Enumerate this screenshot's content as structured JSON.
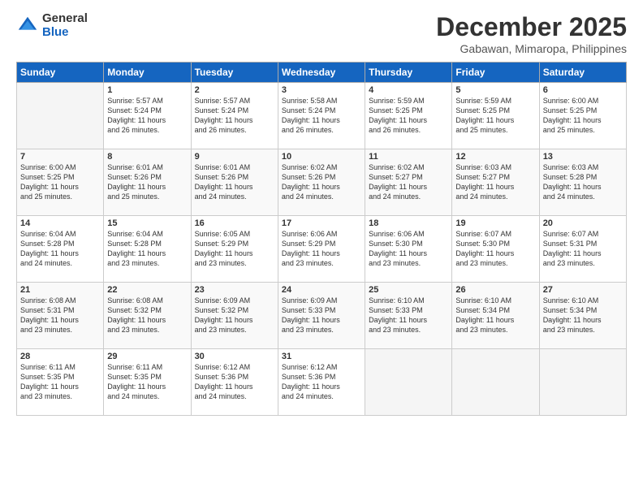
{
  "logo": {
    "general": "General",
    "blue": "Blue"
  },
  "title": "December 2025",
  "subtitle": "Gabawan, Mimaropa, Philippines",
  "weekdays": [
    "Sunday",
    "Monday",
    "Tuesday",
    "Wednesday",
    "Thursday",
    "Friday",
    "Saturday"
  ],
  "weeks": [
    [
      {
        "day": "",
        "info": ""
      },
      {
        "day": "1",
        "info": "Sunrise: 5:57 AM\nSunset: 5:24 PM\nDaylight: 11 hours\nand 26 minutes."
      },
      {
        "day": "2",
        "info": "Sunrise: 5:57 AM\nSunset: 5:24 PM\nDaylight: 11 hours\nand 26 minutes."
      },
      {
        "day": "3",
        "info": "Sunrise: 5:58 AM\nSunset: 5:24 PM\nDaylight: 11 hours\nand 26 minutes."
      },
      {
        "day": "4",
        "info": "Sunrise: 5:59 AM\nSunset: 5:25 PM\nDaylight: 11 hours\nand 26 minutes."
      },
      {
        "day": "5",
        "info": "Sunrise: 5:59 AM\nSunset: 5:25 PM\nDaylight: 11 hours\nand 25 minutes."
      },
      {
        "day": "6",
        "info": "Sunrise: 6:00 AM\nSunset: 5:25 PM\nDaylight: 11 hours\nand 25 minutes."
      }
    ],
    [
      {
        "day": "7",
        "info": "Sunrise: 6:00 AM\nSunset: 5:25 PM\nDaylight: 11 hours\nand 25 minutes."
      },
      {
        "day": "8",
        "info": "Sunrise: 6:01 AM\nSunset: 5:26 PM\nDaylight: 11 hours\nand 25 minutes."
      },
      {
        "day": "9",
        "info": "Sunrise: 6:01 AM\nSunset: 5:26 PM\nDaylight: 11 hours\nand 24 minutes."
      },
      {
        "day": "10",
        "info": "Sunrise: 6:02 AM\nSunset: 5:26 PM\nDaylight: 11 hours\nand 24 minutes."
      },
      {
        "day": "11",
        "info": "Sunrise: 6:02 AM\nSunset: 5:27 PM\nDaylight: 11 hours\nand 24 minutes."
      },
      {
        "day": "12",
        "info": "Sunrise: 6:03 AM\nSunset: 5:27 PM\nDaylight: 11 hours\nand 24 minutes."
      },
      {
        "day": "13",
        "info": "Sunrise: 6:03 AM\nSunset: 5:28 PM\nDaylight: 11 hours\nand 24 minutes."
      }
    ],
    [
      {
        "day": "14",
        "info": "Sunrise: 6:04 AM\nSunset: 5:28 PM\nDaylight: 11 hours\nand 24 minutes."
      },
      {
        "day": "15",
        "info": "Sunrise: 6:04 AM\nSunset: 5:28 PM\nDaylight: 11 hours\nand 23 minutes."
      },
      {
        "day": "16",
        "info": "Sunrise: 6:05 AM\nSunset: 5:29 PM\nDaylight: 11 hours\nand 23 minutes."
      },
      {
        "day": "17",
        "info": "Sunrise: 6:06 AM\nSunset: 5:29 PM\nDaylight: 11 hours\nand 23 minutes."
      },
      {
        "day": "18",
        "info": "Sunrise: 6:06 AM\nSunset: 5:30 PM\nDaylight: 11 hours\nand 23 minutes."
      },
      {
        "day": "19",
        "info": "Sunrise: 6:07 AM\nSunset: 5:30 PM\nDaylight: 11 hours\nand 23 minutes."
      },
      {
        "day": "20",
        "info": "Sunrise: 6:07 AM\nSunset: 5:31 PM\nDaylight: 11 hours\nand 23 minutes."
      }
    ],
    [
      {
        "day": "21",
        "info": "Sunrise: 6:08 AM\nSunset: 5:31 PM\nDaylight: 11 hours\nand 23 minutes."
      },
      {
        "day": "22",
        "info": "Sunrise: 6:08 AM\nSunset: 5:32 PM\nDaylight: 11 hours\nand 23 minutes."
      },
      {
        "day": "23",
        "info": "Sunrise: 6:09 AM\nSunset: 5:32 PM\nDaylight: 11 hours\nand 23 minutes."
      },
      {
        "day": "24",
        "info": "Sunrise: 6:09 AM\nSunset: 5:33 PM\nDaylight: 11 hours\nand 23 minutes."
      },
      {
        "day": "25",
        "info": "Sunrise: 6:10 AM\nSunset: 5:33 PM\nDaylight: 11 hours\nand 23 minutes."
      },
      {
        "day": "26",
        "info": "Sunrise: 6:10 AM\nSunset: 5:34 PM\nDaylight: 11 hours\nand 23 minutes."
      },
      {
        "day": "27",
        "info": "Sunrise: 6:10 AM\nSunset: 5:34 PM\nDaylight: 11 hours\nand 23 minutes."
      }
    ],
    [
      {
        "day": "28",
        "info": "Sunrise: 6:11 AM\nSunset: 5:35 PM\nDaylight: 11 hours\nand 23 minutes."
      },
      {
        "day": "29",
        "info": "Sunrise: 6:11 AM\nSunset: 5:35 PM\nDaylight: 11 hours\nand 24 minutes."
      },
      {
        "day": "30",
        "info": "Sunrise: 6:12 AM\nSunset: 5:36 PM\nDaylight: 11 hours\nand 24 minutes."
      },
      {
        "day": "31",
        "info": "Sunrise: 6:12 AM\nSunset: 5:36 PM\nDaylight: 11 hours\nand 24 minutes."
      },
      {
        "day": "",
        "info": ""
      },
      {
        "day": "",
        "info": ""
      },
      {
        "day": "",
        "info": ""
      }
    ]
  ]
}
